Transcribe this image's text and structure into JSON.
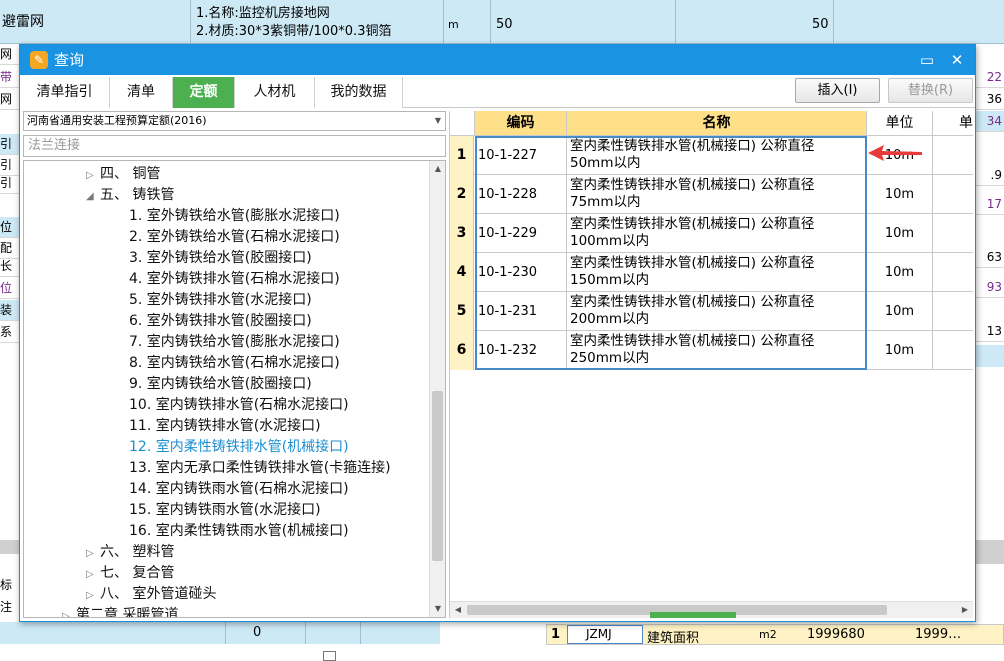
{
  "background": {
    "top_row": {
      "left_text": "避雷网",
      "desc_line1": "1.名称:监控机房接地网",
      "desc_line2": "2.材质:30*3紫铜带/100*0.3铜箔",
      "unit": "m",
      "qty1": "50",
      "qty2": "50"
    },
    "left_fragments": [
      "网",
      "带",
      "网",
      "引",
      "引",
      "引",
      "位",
      "配",
      "长",
      "位",
      "装",
      "系"
    ],
    "right_fragments": [
      "22",
      "36",
      "34",
      ".9",
      "17",
      "63",
      "93",
      "13"
    ],
    "bottom": {
      "left_label": "标注",
      "left_value": "0",
      "row_num": "1",
      "code": "JZMJ",
      "name": "建筑面积",
      "unit": "m2",
      "value": "1999680",
      "value2": "1999…"
    }
  },
  "dialog": {
    "title": "查询",
    "icon": "pencil-icon",
    "tabs": [
      {
        "label": "清单指引",
        "active": false
      },
      {
        "label": "清单",
        "active": false
      },
      {
        "label": "定额",
        "active": true
      },
      {
        "label": "人材机",
        "active": false
      },
      {
        "label": "我的数据",
        "active": false
      }
    ],
    "insert_button": "插入(I)",
    "replace_button": "替换(R)",
    "quota_library": "河南省通用安装工程预算定额(2016)",
    "search_value": "法兰连接",
    "tree": [
      {
        "label": "四、 铜管",
        "toggle": "collapsed"
      },
      {
        "label": "五、 铸铁管",
        "toggle": "expanded"
      },
      {
        "label": "1. 室外铸铁给水管(膨胀水泥接口)"
      },
      {
        "label": "2. 室外铸铁给水管(石棉水泥接口)"
      },
      {
        "label": "3. 室外铸铁给水管(胶圈接口)"
      },
      {
        "label": "4. 室外铸铁排水管(石棉水泥接口)"
      },
      {
        "label": "5. 室外铸铁排水管(水泥接口)"
      },
      {
        "label": "6. 室外铸铁排水管(胶圈接口)"
      },
      {
        "label": "7. 室内铸铁给水管(膨胀水泥接口)"
      },
      {
        "label": "8. 室内铸铁给水管(石棉水泥接口)"
      },
      {
        "label": "9. 室内铸铁给水管(胶圈接口)"
      },
      {
        "label": "10. 室内铸铁排水管(石棉水泥接口)"
      },
      {
        "label": "11. 室内铸铁排水管(水泥接口)"
      },
      {
        "label": "12. 室内柔性铸铁排水管(机械接口)",
        "selected": true
      },
      {
        "label": "13. 室内无承口柔性铸铁排水管(卡箍连接)"
      },
      {
        "label": "14. 室内铸铁雨水管(石棉水泥接口)"
      },
      {
        "label": "15. 室内铸铁雨水管(水泥接口)"
      },
      {
        "label": "16. 室内柔性铸铁雨水管(机械接口)"
      },
      {
        "label": "六、 塑料管",
        "toggle": "collapsed"
      },
      {
        "label": "七、 复合管",
        "toggle": "collapsed"
      },
      {
        "label": "八、 室外管道碰头",
        "toggle": "collapsed"
      },
      {
        "label": "第二章 采暖管道",
        "toggle": "collapsed"
      }
    ],
    "grid": {
      "headers": {
        "code": "编码",
        "name": "名称",
        "unit": "单位",
        "extra": "单"
      },
      "rows": [
        {
          "num": "1",
          "code": "10-1-227",
          "name_line1": "室内柔性铸铁排水管(机械接口) 公称直径",
          "name_line2": "50mm以内",
          "unit": "10m"
        },
        {
          "num": "2",
          "code": "10-1-228",
          "name_line1": "室内柔性铸铁排水管(机械接口) 公称直径",
          "name_line2": "75mm以内",
          "unit": "10m"
        },
        {
          "num": "3",
          "code": "10-1-229",
          "name_line1": "室内柔性铸铁排水管(机械接口) 公称直径",
          "name_line2": "100mm以内",
          "unit": "10m"
        },
        {
          "num": "4",
          "code": "10-1-230",
          "name_line1": "室内柔性铸铁排水管(机械接口) 公称直径",
          "name_line2": "150mm以内",
          "unit": "10m"
        },
        {
          "num": "5",
          "code": "10-1-231",
          "name_line1": "室内柔性铸铁排水管(机械接口) 公称直径",
          "name_line2": "200mm以内",
          "unit": "10m"
        },
        {
          "num": "6",
          "code": "10-1-232",
          "name_line1": "室内柔性铸铁排水管(机械接口) 公称直径",
          "name_line2": "250mm以内",
          "unit": "10m"
        }
      ]
    }
  },
  "colors": {
    "title_bar": "#1a93e2",
    "active_tab": "#4caf50",
    "selected_tree_item": "#1e8fd0",
    "header_yellow": "#ffe08a",
    "annotation_arrow": "#e83a3a"
  }
}
